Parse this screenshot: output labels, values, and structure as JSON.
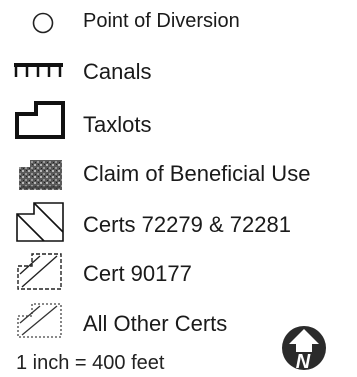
{
  "legend": {
    "items": [
      {
        "label": "Point of Diversion",
        "icon": "circle-icon"
      },
      {
        "label": "Canals",
        "icon": "canal-line-icon"
      },
      {
        "label": "Taxlots",
        "icon": "taxlot-polygon-icon"
      },
      {
        "label": "Claim of Beneficial Use",
        "icon": "stippled-fill-icon"
      },
      {
        "label": "Certs 72279 & 72281",
        "icon": "hatched-polygon-icon"
      },
      {
        "label": "Cert 90177",
        "icon": "dashed-hatched-polygon-icon"
      },
      {
        "label": "All Other Certs",
        "icon": "dotted-hatched-polygon-icon"
      }
    ],
    "scale": "1 inch = 400 feet",
    "north_arrow_letter": "N"
  },
  "colors": {
    "ink": "#1a1a1a",
    "stipple_dark": "#3a3a3a",
    "north_badge": "#2b2b2b"
  }
}
